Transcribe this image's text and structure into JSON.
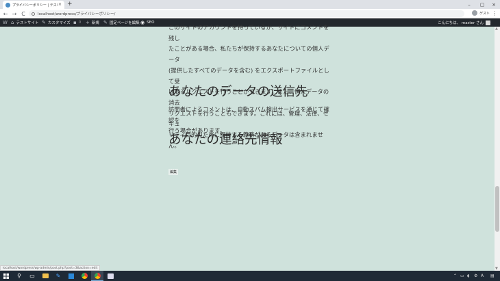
{
  "browser": {
    "tab_title": "プライバシーポリシー | テストサイト",
    "tab_close": "×",
    "new_tab": "+",
    "url": "localhost/wordpress/プライバシーポリシー/",
    "profile_name": "ゲスト",
    "menu": "⋮",
    "nav": {
      "back": "←",
      "forward": "→",
      "reload": "C"
    },
    "window": {
      "minimize": "–",
      "maximize": "▢",
      "close": "×"
    }
  },
  "admin_bar": {
    "wp_logo": "W",
    "site_name": "テストサイト",
    "customize": "カスタマイズ",
    "comments_count": "0",
    "new": "新規",
    "edit_page": "固定ページを編集",
    "seo": "SEO",
    "greeting": "こんにちは、 master さん"
  },
  "content": {
    "paragraph_1_lines": [
      "このサイトのアカウントを持っているか、サイトにコメントを残し",
      "たことがある場合、私たちが保持するあなたについての個人データ",
      "(提供したすべてのデータを含む) をエクスポートファイルとして受",
      "け取るリクエストを行うことができます。また、個人データの消去",
      "リクエストを行うこともできます。これには、管理、法律、セキュ",
      "リティ目的のために保持する義務があるデータは含まれません。"
    ],
    "heading_1": "あなたのデータの送信先",
    "paragraph_2_lines": [
      "訪問者によるコメントは、自動スパム検出サービスを通じて確認を",
      "行う場合があります。"
    ],
    "heading_2": "あなたの連絡先情報",
    "edit_link": "編集"
  },
  "status_url": "localhost/wordpress/wp-admin/post.php?post=3&action=edit",
  "taskbar": {
    "time": "",
    "tray_icons": [
      "chevron-up-icon",
      "network-icon",
      "volume-icon",
      "battery-icon",
      "notification-icon"
    ]
  }
}
